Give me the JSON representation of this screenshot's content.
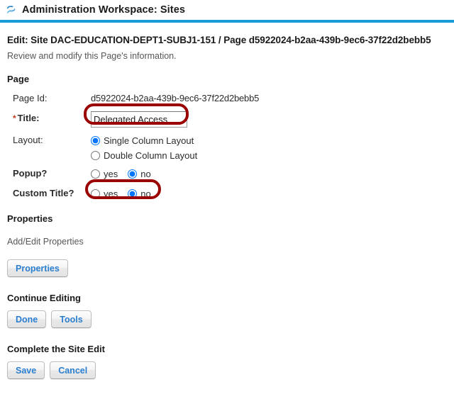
{
  "header": {
    "icon": "sakai-swirl-icon",
    "title": "Administration Workspace: Sites",
    "accent_color": "#189cd8"
  },
  "page": {
    "edit_heading": "Edit: Site DAC-EDUCATION-DEPT1-SUBJ1-151 / Page d5922024-b2aa-439b-9ec6-37f22d2bebb5",
    "edit_subtitle": "Review and modify this Page's information.",
    "section_label": "Page"
  },
  "fields": {
    "page_id": {
      "label": "Page Id:",
      "value": "d5922024-b2aa-439b-9ec6-37f22d2bebb5"
    },
    "title": {
      "required_marker": "*",
      "label": "Title:",
      "value": "Delegated Access",
      "placeholder": ""
    },
    "layout": {
      "label": "Layout:",
      "options": [
        {
          "label": "Single Column Layout",
          "selected": true
        },
        {
          "label": "Double Column Layout",
          "selected": false
        }
      ]
    },
    "popup": {
      "label": "Popup?",
      "options": [
        {
          "label": "yes",
          "selected": false
        },
        {
          "label": "no",
          "selected": true
        }
      ]
    },
    "custom_title": {
      "label": "Custom Title?",
      "options": [
        {
          "label": "yes",
          "selected": false
        },
        {
          "label": "no",
          "selected": true
        }
      ]
    }
  },
  "properties": {
    "section_label": "Properties",
    "hint": "Add/Edit Properties",
    "button_label": "Properties"
  },
  "continue_editing": {
    "section_label": "Continue Editing",
    "done_label": "Done",
    "tools_label": "Tools"
  },
  "complete": {
    "section_label": "Complete the Site Edit",
    "save_label": "Save",
    "cancel_label": "Cancel"
  },
  "annotations": {
    "color": "#9b0000",
    "title_field_callout": "title-input-highlight",
    "custom_title_callout": "custom-title-radio-highlight"
  }
}
